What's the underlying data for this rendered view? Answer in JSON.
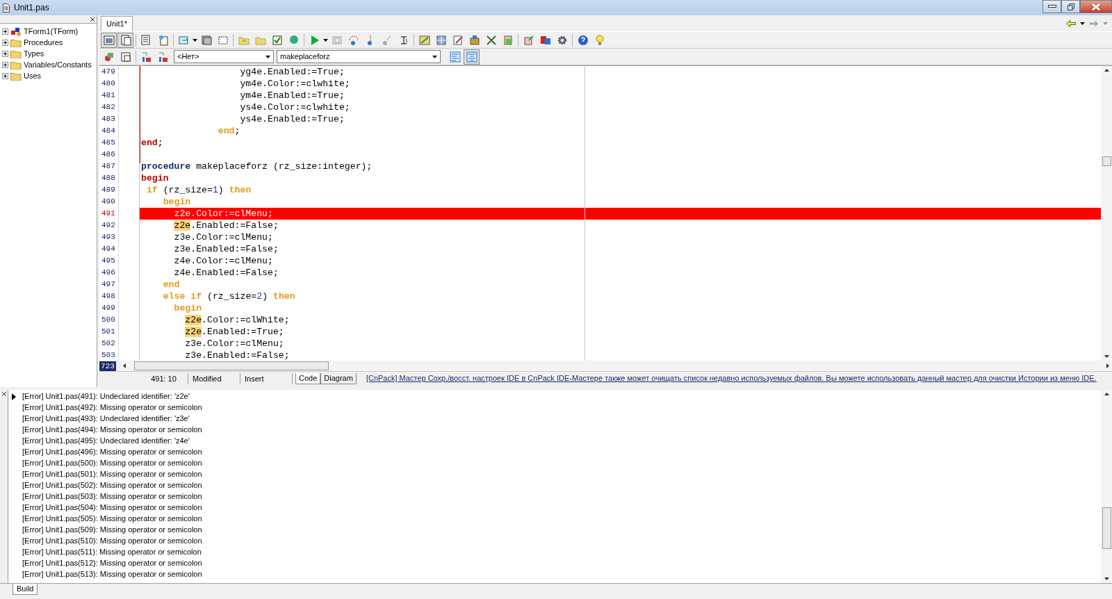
{
  "window": {
    "title": "Unit1.pas"
  },
  "structure_tree": [
    {
      "label": "TForm1(TForm)",
      "kind": "form",
      "expanded": false
    },
    {
      "label": "Procedures",
      "kind": "folder",
      "expanded": false
    },
    {
      "label": "Types",
      "kind": "folder",
      "expanded": false
    },
    {
      "label": "Variables/Constants",
      "kind": "folder",
      "expanded": false
    },
    {
      "label": "Uses",
      "kind": "folder",
      "expanded": false
    }
  ],
  "editor_tabs": [
    {
      "label": "Unit1*",
      "selected": true
    }
  ],
  "class_combo": {
    "value": "<Нет>"
  },
  "method_combo": {
    "value": "makeplaceforz"
  },
  "code_lines": [
    {
      "number": "479",
      "error": false,
      "segments": [
        {
          "text": "                  yg4e.Enabled:=True;",
          "kind": "plain"
        }
      ]
    },
    {
      "number": "480",
      "error": false,
      "segments": [
        {
          "text": "                  ym4e.Color:=clwhite;",
          "kind": "plain"
        }
      ]
    },
    {
      "number": "481",
      "error": false,
      "segments": [
        {
          "text": "                  ym4e.Enabled:=True;",
          "kind": "plain"
        }
      ]
    },
    {
      "number": "482",
      "error": false,
      "segments": [
        {
          "text": "                  ys4e.Color:=clwhite;",
          "kind": "plain"
        }
      ]
    },
    {
      "number": "483",
      "error": false,
      "segments": [
        {
          "text": "                  ys4e.Enabled:=True;",
          "kind": "plain"
        }
      ]
    },
    {
      "number": "484",
      "error": false,
      "segments": [
        {
          "text": "              end",
          "kind": "keyword"
        },
        {
          "text": ";",
          "kind": "plain"
        }
      ]
    },
    {
      "number": "485",
      "error": false,
      "segments": [
        {
          "text": "end",
          "kind": "block"
        },
        {
          "text": ";",
          "kind": "plain"
        }
      ]
    },
    {
      "number": "486",
      "error": false
    },
    {
      "number": "487",
      "error": false,
      "segments": [
        {
          "text": "procedure",
          "kind": "declaration"
        },
        {
          "text": " makeplaceforz (rz_size:integer);",
          "kind": "plain"
        }
      ]
    },
    {
      "number": "488",
      "error": false,
      "segments": [
        {
          "text": "begin",
          "kind": "block"
        }
      ]
    },
    {
      "number": "489",
      "error": false,
      "segments": [
        {
          "text": " if",
          "kind": "keyword"
        },
        {
          "text": " (rz_size=",
          "kind": "plain"
        },
        {
          "text": "1",
          "kind": "number"
        },
        {
          "text": ") ",
          "kind": "plain"
        },
        {
          "text": "then",
          "kind": "keyword"
        }
      ]
    },
    {
      "number": "490",
      "error": false,
      "segments": [
        {
          "text": "    begin",
          "kind": "keyword"
        }
      ]
    },
    {
      "number": "491",
      "error": true,
      "segments": [
        {
          "text": "      z2e.Color:=clMenu;",
          "kind": "plain"
        }
      ]
    },
    {
      "number": "492",
      "error": false,
      "segments": [
        {
          "text": "      z2e",
          "kind": "match"
        },
        {
          "text": ".Enabled:=False;",
          "kind": "plain"
        }
      ]
    },
    {
      "number": "493",
      "error": false,
      "segments": [
        {
          "text": "      z3e.Color:=clMenu;",
          "kind": "plain"
        }
      ]
    },
    {
      "number": "494",
      "error": false,
      "segments": [
        {
          "text": "      z3e.Enabled:=False;",
          "kind": "plain"
        }
      ]
    },
    {
      "number": "495",
      "error": false,
      "segments": [
        {
          "text": "      z4e.Color:=clMenu;",
          "kind": "plain"
        }
      ]
    },
    {
      "number": "496",
      "error": false,
      "segments": [
        {
          "text": "      z4e.Enabled:=False;",
          "kind": "plain"
        }
      ]
    },
    {
      "number": "497",
      "error": false,
      "segments": [
        {
          "text": "    end",
          "kind": "keyword"
        }
      ]
    },
    {
      "number": "498",
      "error": false,
      "segments": [
        {
          "text": "    else",
          "kind": "keyword"
        },
        {
          "text": " if",
          "kind": "keyword"
        },
        {
          "text": " (rz_size=",
          "kind": "plain"
        },
        {
          "text": "2",
          "kind": "number"
        },
        {
          "text": ") ",
          "kind": "plain"
        },
        {
          "text": "then",
          "kind": "keyword"
        }
      ]
    },
    {
      "number": "499",
      "error": false,
      "segments": [
        {
          "text": "      begin",
          "kind": "keyword"
        }
      ]
    },
    {
      "number": "500",
      "error": false,
      "segments": [
        {
          "text": "        z2e",
          "kind": "match"
        },
        {
          "text": ".Color:=clWhite;",
          "kind": "plain"
        }
      ]
    },
    {
      "number": "501",
      "error": false,
      "segments": [
        {
          "text": "        z2e",
          "kind": "match"
        },
        {
          "text": ".Enabled:=True;",
          "kind": "plain"
        }
      ]
    },
    {
      "number": "502",
      "error": false,
      "segments": [
        {
          "text": "        z3e.Color:=clMenu;",
          "kind": "plain"
        }
      ]
    },
    {
      "number": "503",
      "error": false,
      "segments": [
        {
          "text": "        z3e.Enabled:=False;",
          "kind": "plain"
        }
      ]
    }
  ],
  "line_count": "723",
  "status_bar": {
    "position": "491: 10",
    "modified": "Modified",
    "mode": "Insert",
    "view_tabs": [
      {
        "label": "Code",
        "selected": true
      },
      {
        "label": "Diagram",
        "selected": false
      }
    ],
    "hint": "[CnPack] Мастер Сохр./восст. настроек IDE в CnPack IDE-Мастере также может очищать список недавно используемых файлов. Вы можете использовать данный мастер для очистки Истории из меню IDE."
  },
  "messages": [
    "[Error] Unit1.pas(491): Undeclared identifier: 'z2e'",
    "[Error] Unit1.pas(492): Missing operator or semicolon",
    "[Error] Unit1.pas(493): Undeclared identifier: 'z3e'",
    "[Error] Unit1.pas(494): Missing operator or semicolon",
    "[Error] Unit1.pas(495): Undeclared identifier: 'z4e'",
    "[Error] Unit1.pas(496): Missing operator or semicolon",
    "[Error] Unit1.pas(500): Missing operator or semicolon",
    "[Error] Unit1.pas(501): Missing operator or semicolon",
    "[Error] Unit1.pas(502): Missing operator or semicolon",
    "[Error] Unit1.pas(503): Missing operator or semicolon",
    "[Error] Unit1.pas(504): Missing operator or semicolon",
    "[Error] Unit1.pas(505): Missing operator or semicolon",
    "[Error] Unit1.pas(509): Missing operator or semicolon",
    "[Error] Unit1.pas(510): Missing operator or semicolon",
    "[Error] Unit1.pas(511): Missing operator or semicolon",
    "[Error] Unit1.pas(512): Missing operator or semicolon",
    "[Error] Unit1.pas(513): Missing operator or semicolon"
  ],
  "message_tabs": [
    {
      "label": "Build",
      "selected": true
    }
  ]
}
